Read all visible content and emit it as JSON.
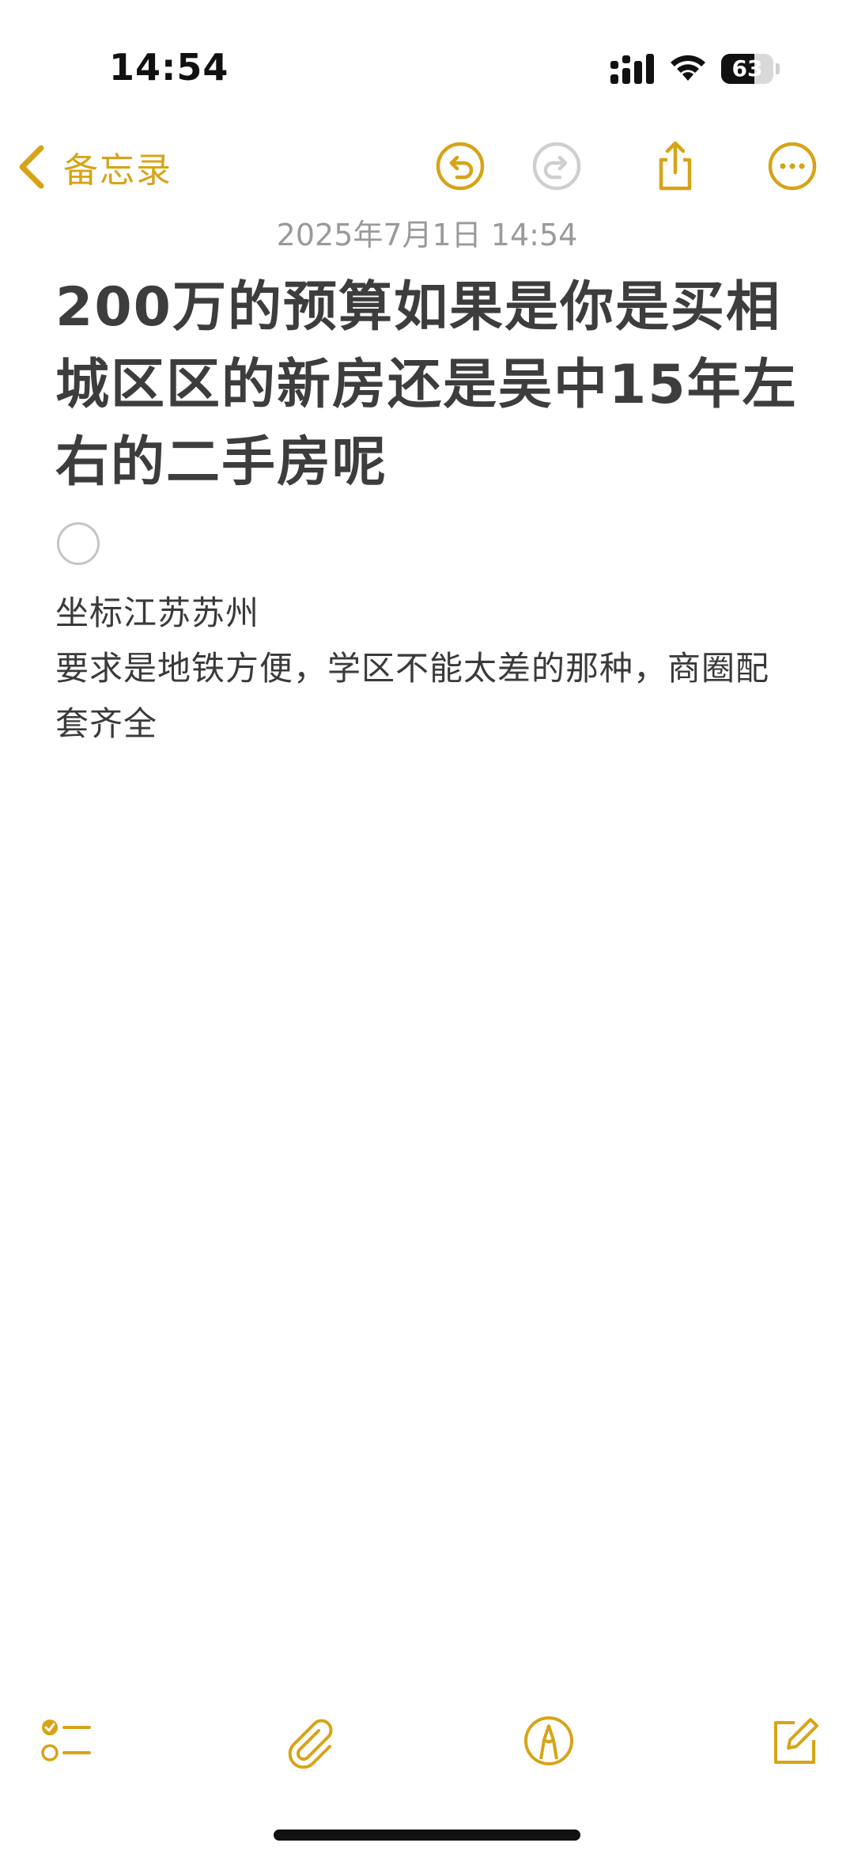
{
  "status_bar": {
    "time": "14:54",
    "battery_percent": 63,
    "battery_label": "63"
  },
  "nav": {
    "back_label": "备忘录"
  },
  "note": {
    "date": "2025年7月1日 14:54",
    "title": "200万的预算如果是你是买相城区区的新房还是吴中15年左右的二手房呢",
    "checklist_item_checked": false,
    "body_lines": [
      "坐标江苏苏州",
      "要求是地铁方便，学区不能太差的那种，商圈配套齐全"
    ]
  },
  "colors": {
    "accent": "#d7a417",
    "text": "#3d3d3d",
    "secondary": "#9a9a9a"
  },
  "icons": {
    "back": "chevron-left-icon",
    "undo": "undo-icon",
    "redo": "redo-icon",
    "share": "share-icon",
    "more": "more-icon",
    "checklist": "checklist-icon",
    "attachment": "paperclip-icon",
    "markup": "markup-pen-icon",
    "compose": "compose-icon"
  }
}
